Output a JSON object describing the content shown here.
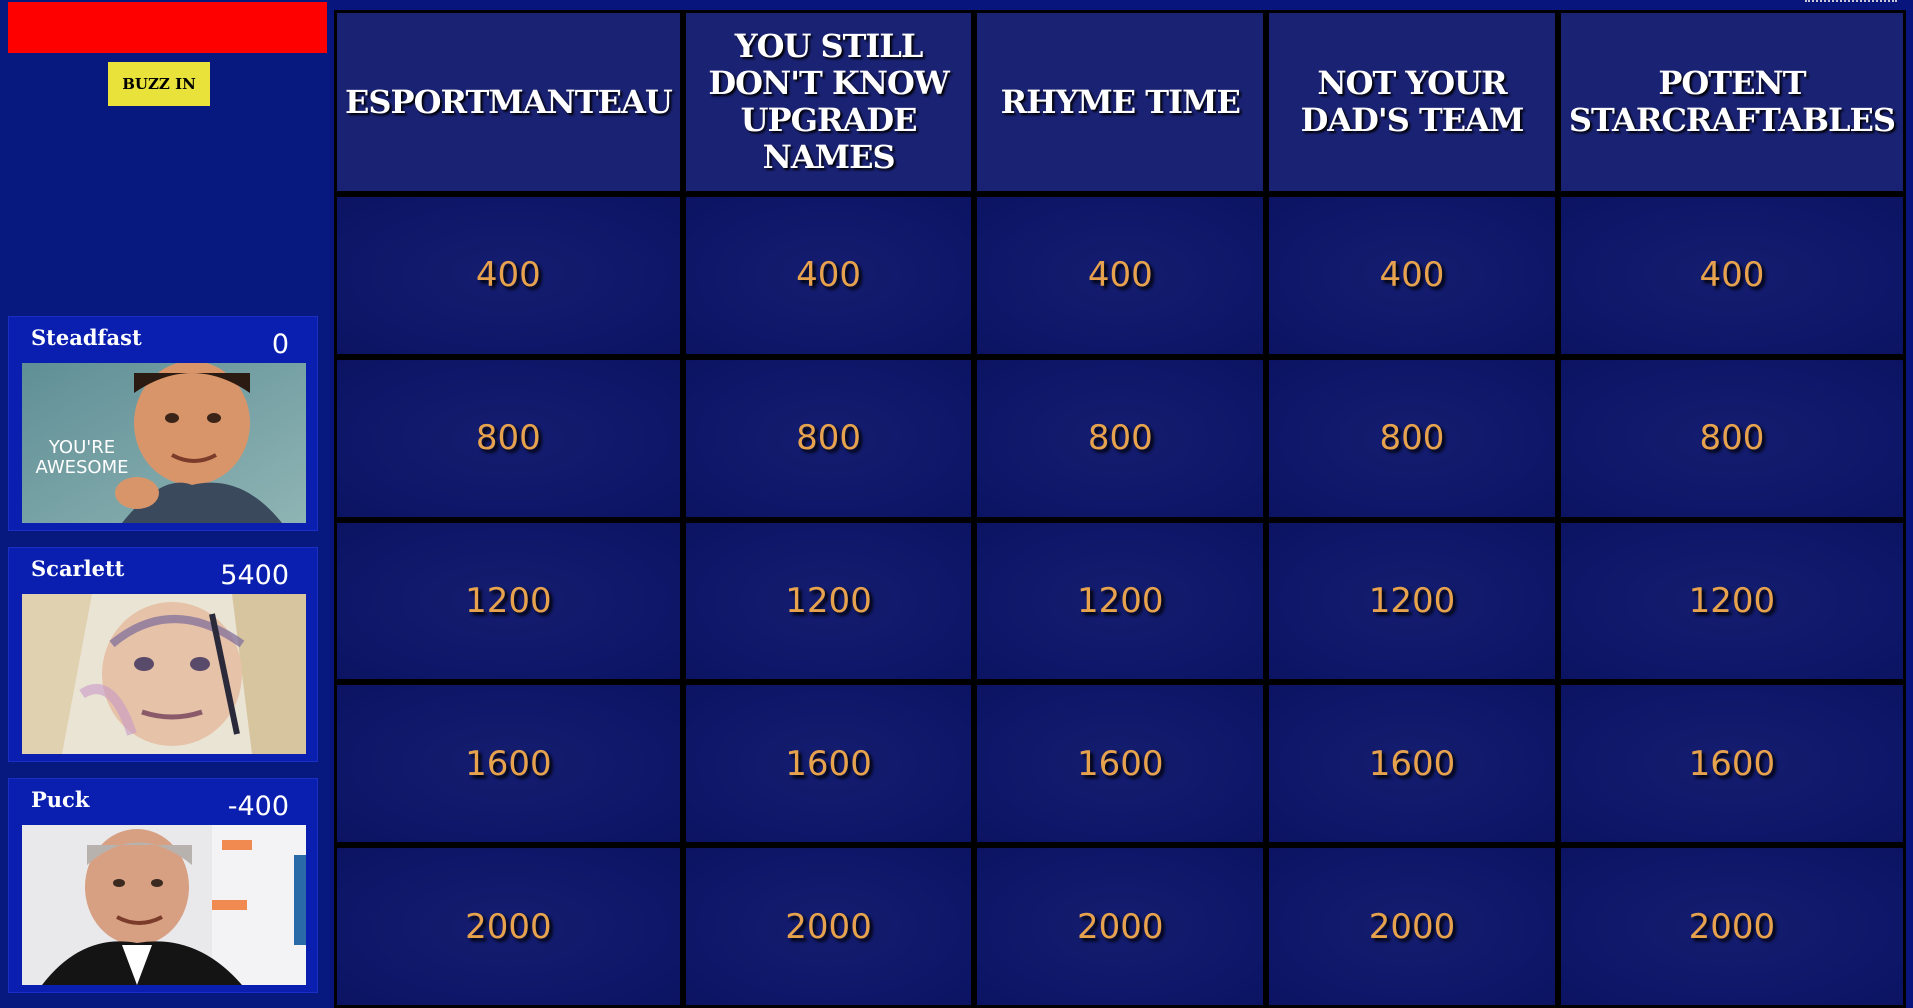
{
  "buzz": {
    "label": "BUZZ IN",
    "bar_color": "#ff0000",
    "button_color": "#e8e23a"
  },
  "players": [
    {
      "name": "Steadfast",
      "score": "0",
      "photo_caption": [
        "YOU'RE",
        "AWESOME"
      ]
    },
    {
      "name": "Scarlett",
      "score": "5400"
    },
    {
      "name": "Puck",
      "score": "-400"
    }
  ],
  "board": {
    "categories": [
      "ESPORTMANTEAU",
      "YOU STILL DON'T KNOW UPGRADE NAMES",
      "RHYME TIME",
      "NOT YOUR DAD'S TEAM",
      "POTENT STARCRAFTABLES"
    ],
    "values": [
      "400",
      "800",
      "1200",
      "1600",
      "2000"
    ],
    "value_color": "#e7a24e",
    "cell_color": "#141d6e"
  }
}
